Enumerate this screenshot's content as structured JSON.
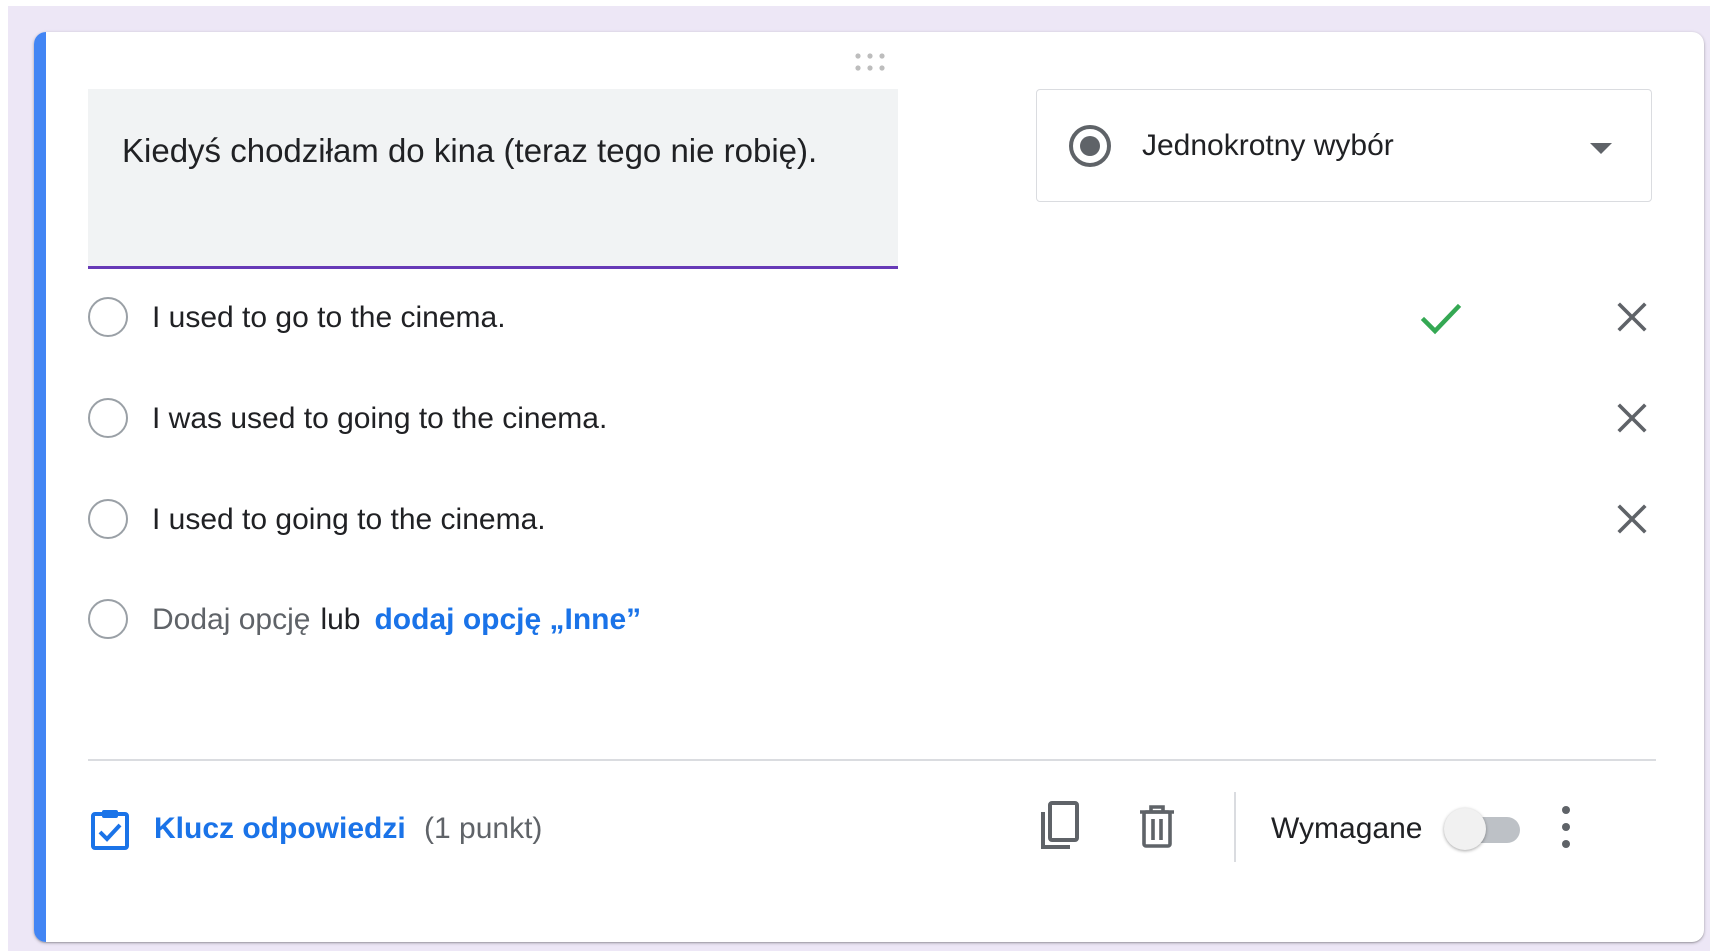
{
  "question": {
    "text": "Kiedyś chodziłam do kina (teraz tego nie robię)."
  },
  "type_select": {
    "label": "Jednokrotny wybór",
    "icon": "radio-button-checked-icon"
  },
  "options": [
    {
      "label": "I used to go to the cinema.",
      "correct": true
    },
    {
      "label": "I was used to going to the cinema.",
      "correct": false
    },
    {
      "label": "I used to going to the cinema.",
      "correct": false
    }
  ],
  "add_option": {
    "add_label": "Dodaj opcję",
    "or_label": "lub",
    "add_other_label": "dodaj opcję „Inne”"
  },
  "footer": {
    "answer_key_label": "Klucz odpowiedzi",
    "points_label": "(1 punkt)",
    "required_label": "Wymagane",
    "required_on": false
  },
  "colors": {
    "accent": "#4285f4",
    "title_underline": "#673ab7",
    "link": "#1a73e8",
    "correct_check": "#34a853",
    "background": "#ede7f6"
  }
}
